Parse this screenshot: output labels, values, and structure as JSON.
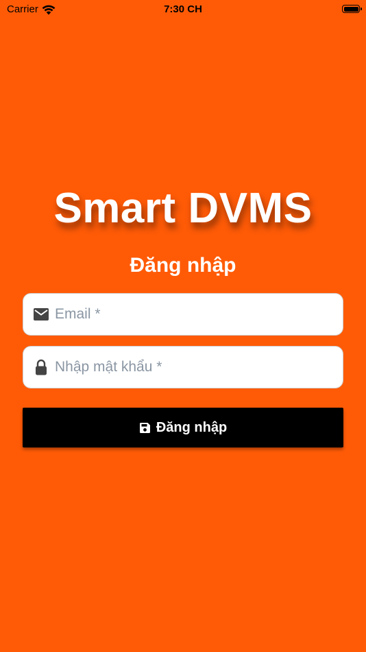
{
  "status_bar": {
    "carrier": "Carrier",
    "time": "7:30 CH",
    "wifi_icon": "wifi-icon",
    "battery_icon": "battery-icon"
  },
  "app": {
    "title": "Smart DVMS",
    "form_title": "Đăng nhập"
  },
  "form": {
    "email": {
      "value": "",
      "placeholder": "Email *",
      "icon": "mail-icon"
    },
    "password": {
      "value": "",
      "placeholder": "Nhập mật khẩu *",
      "icon": "lock-icon"
    },
    "submit": {
      "label": "Đăng nhập",
      "icon": "save-icon"
    }
  },
  "colors": {
    "background": "#FF5B07",
    "button": "#000000",
    "text_on_bg": "#FFFFFF",
    "placeholder": "#8A96A3"
  }
}
